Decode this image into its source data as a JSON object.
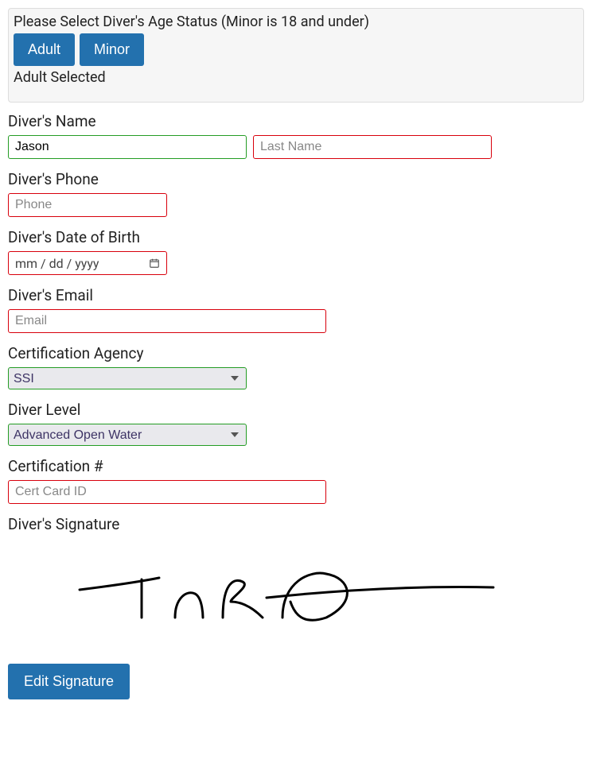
{
  "ageStatus": {
    "title": "Please Select Diver's Age Status (Minor is 18 and under)",
    "adultLabel": "Adult",
    "minorLabel": "Minor",
    "selectedText": "Adult Selected"
  },
  "name": {
    "label": "Diver's Name",
    "firstValue": "Jason",
    "lastValue": "",
    "lastPlaceholder": "Last Name"
  },
  "phone": {
    "label": "Diver's Phone",
    "value": "",
    "placeholder": "Phone"
  },
  "dob": {
    "label": "Diver's Date of Birth",
    "placeholder": "mm / dd / yyyy"
  },
  "email": {
    "label": "Diver's Email",
    "value": "",
    "placeholder": "Email"
  },
  "agency": {
    "label": "Certification Agency",
    "selected": "SSI"
  },
  "level": {
    "label": "Diver Level",
    "selected": "Advanced Open Water"
  },
  "cert": {
    "label": "Certification #",
    "value": "",
    "placeholder": "Cert Card ID"
  },
  "signature": {
    "label": "Diver's Signature",
    "editButton": "Edit Signature"
  }
}
